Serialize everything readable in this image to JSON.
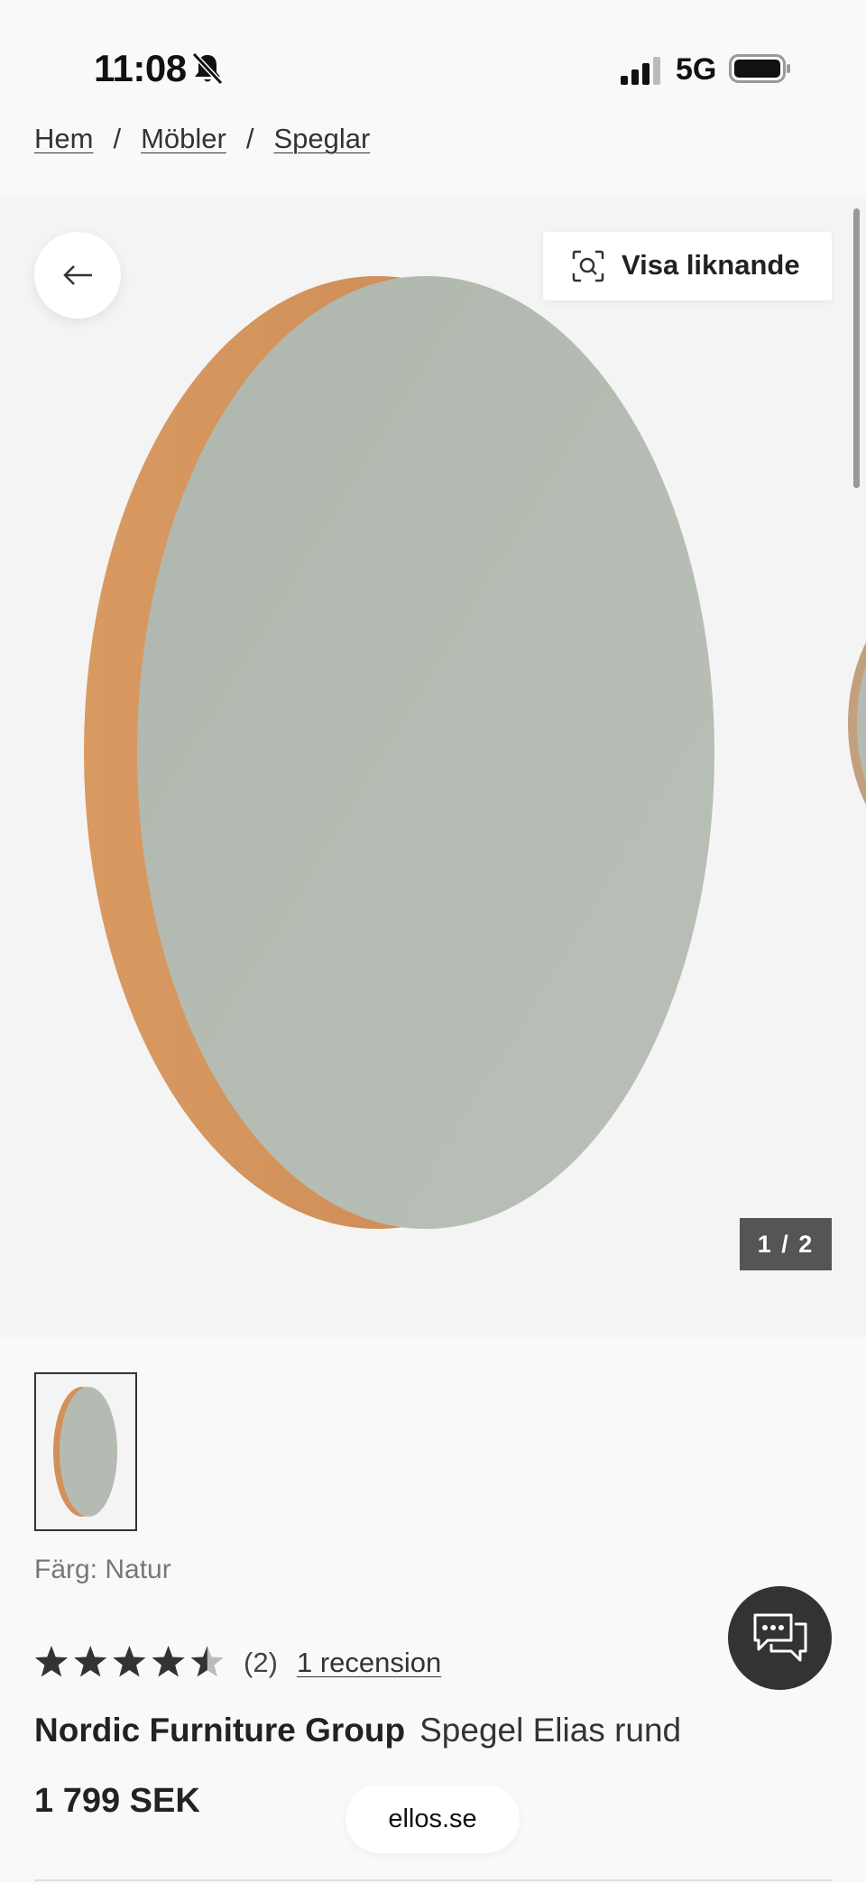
{
  "status_bar": {
    "time": "11:08",
    "network": "5G",
    "icons": [
      "bell-muted-icon",
      "signal-icon",
      "battery-icon"
    ]
  },
  "breadcrumb": {
    "items": [
      "Hem",
      "Möbler",
      "Speglar"
    ],
    "separator": "/"
  },
  "gallery": {
    "back_icon": "arrow-left-icon",
    "similar_label": "Visa liknande",
    "similar_icon": "visual-search-icon",
    "counter": "1 / 2"
  },
  "product": {
    "color_label": "Färg: Natur",
    "rating_value": 4.5,
    "rating_max": 5,
    "review_count": "(2)",
    "review_link": "1 recension",
    "brand": "Nordic Furniture Group",
    "name": "Spegel Elias rund",
    "price": "1 799 SEK"
  },
  "chat": {
    "icon": "chat-bubbles-icon"
  },
  "browser": {
    "url": "ellos.se"
  },
  "colors": {
    "background": "#f9f9fa",
    "gallery_bg": "#f4f4f4",
    "mirror_glass": "#b3bab2",
    "wood_frame": "#d9955e",
    "counter_bg": "#555555",
    "chat_bg": "#333333"
  }
}
